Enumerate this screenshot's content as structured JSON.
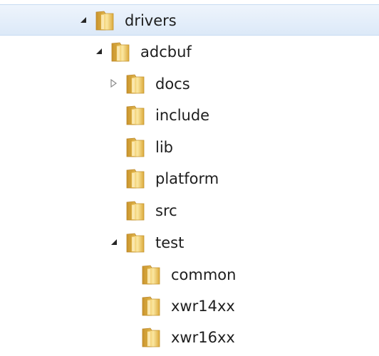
{
  "tree": {
    "items": [
      {
        "label": "drivers",
        "expanded": true,
        "selected": true,
        "icon": "folder-icon",
        "toggle": "expanded-arrow-icon"
      },
      {
        "label": "adcbuf",
        "expanded": true,
        "icon": "folder-icon",
        "toggle": "expanded-arrow-icon"
      },
      {
        "label": "docs",
        "expanded": false,
        "icon": "folder-icon",
        "toggle": "collapsed-arrow-icon"
      },
      {
        "label": "include",
        "icon": "folder-icon"
      },
      {
        "label": "lib",
        "icon": "folder-icon"
      },
      {
        "label": "platform",
        "icon": "folder-icon"
      },
      {
        "label": "src",
        "icon": "folder-icon"
      },
      {
        "label": "test",
        "expanded": true,
        "icon": "folder-icon",
        "toggle": "expanded-arrow-icon"
      },
      {
        "label": "common",
        "icon": "folder-icon"
      },
      {
        "label": "xwr14xx",
        "icon": "folder-icon"
      },
      {
        "label": "xwr16xx",
        "icon": "folder-icon"
      }
    ]
  },
  "colors": {
    "selection_background": "#dce9f8",
    "selection_border": "#c7dbf2",
    "text": "#1e1e1e",
    "folder_light": "#f7dc8a",
    "folder_dark": "#d9a935"
  }
}
